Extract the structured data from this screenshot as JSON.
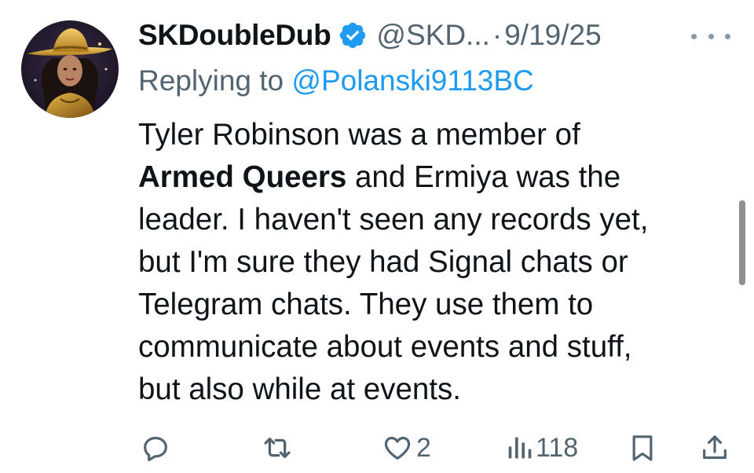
{
  "tweet": {
    "display_name": "SKDoubleDub",
    "handle": "@SKD...",
    "separator": "·",
    "date": "9/19/25",
    "replying_prefix": "Replying to ",
    "replying_to": "@Polanski9113BC",
    "body": {
      "line1": "Tyler Robinson was a member of",
      "line2_bold": "Armed Queers",
      "line2_rest": " and Ermiya was the",
      "line3": "leader. I haven't seen any records yet,",
      "line4": "but I'm sure they had Signal chats or",
      "line5": "Telegram chats. They use them to",
      "line6": "communicate about events and stuff,",
      "line7": "but also while at events."
    }
  },
  "actions": {
    "reply_count": "",
    "retweet_count": "",
    "like_count": "2",
    "views_count": "118"
  },
  "icons": {
    "verified": "verified-badge-icon",
    "more": "more-icon",
    "reply": "reply-icon",
    "retweet": "retweet-icon",
    "like": "heart-icon",
    "views": "views-icon",
    "bookmark": "bookmark-icon",
    "share": "share-icon"
  },
  "colors": {
    "text": "#0f1419",
    "secondary": "#536471",
    "link": "#1d9bf0",
    "verified": "#1d9bf0"
  }
}
